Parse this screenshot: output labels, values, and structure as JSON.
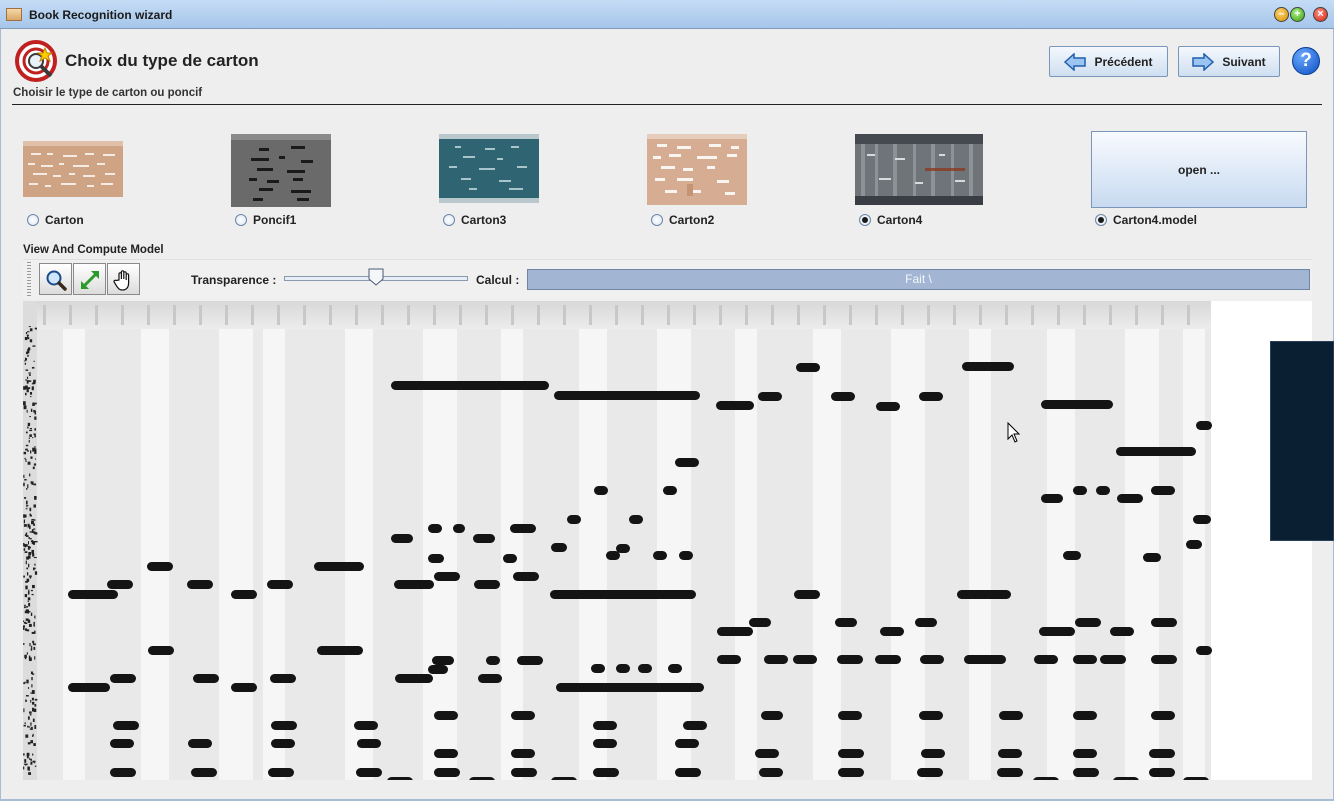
{
  "window": {
    "title": "Book Recognition wizard",
    "controls": [
      "minimize-icon",
      "maximize-icon",
      "close-icon"
    ]
  },
  "header": {
    "title": "Choix du type de carton",
    "subtitle": "Choisir le type de carton ou poncif",
    "prev_label": "Précédent",
    "next_label": "Suivant",
    "help_label": "?"
  },
  "cartons": {
    "items": [
      {
        "label": "Carton",
        "selected": false
      },
      {
        "label": "Poncif1",
        "selected": false
      },
      {
        "label": "Carton3",
        "selected": false
      },
      {
        "label": "Carton2",
        "selected": false
      },
      {
        "label": "Carton4",
        "selected": true
      },
      {
        "label": "Carton4.model",
        "selected": true
      }
    ],
    "open_label": "open ..."
  },
  "model": {
    "section_label": "View And Compute Model",
    "tools": [
      "zoom-icon",
      "fit-icon",
      "pan-hand-icon"
    ],
    "transparence_label": "Transparence :",
    "transparence_value": 0.5,
    "calcul_label": "Calcul :",
    "progress_text": "Fait  \\",
    "progress_value": 1.0
  },
  "colors": {
    "accent": "#a2b5d2",
    "titlebar": "#b6d1ef",
    "perforation": "#141414",
    "side_panel": "#0b1f33"
  }
}
